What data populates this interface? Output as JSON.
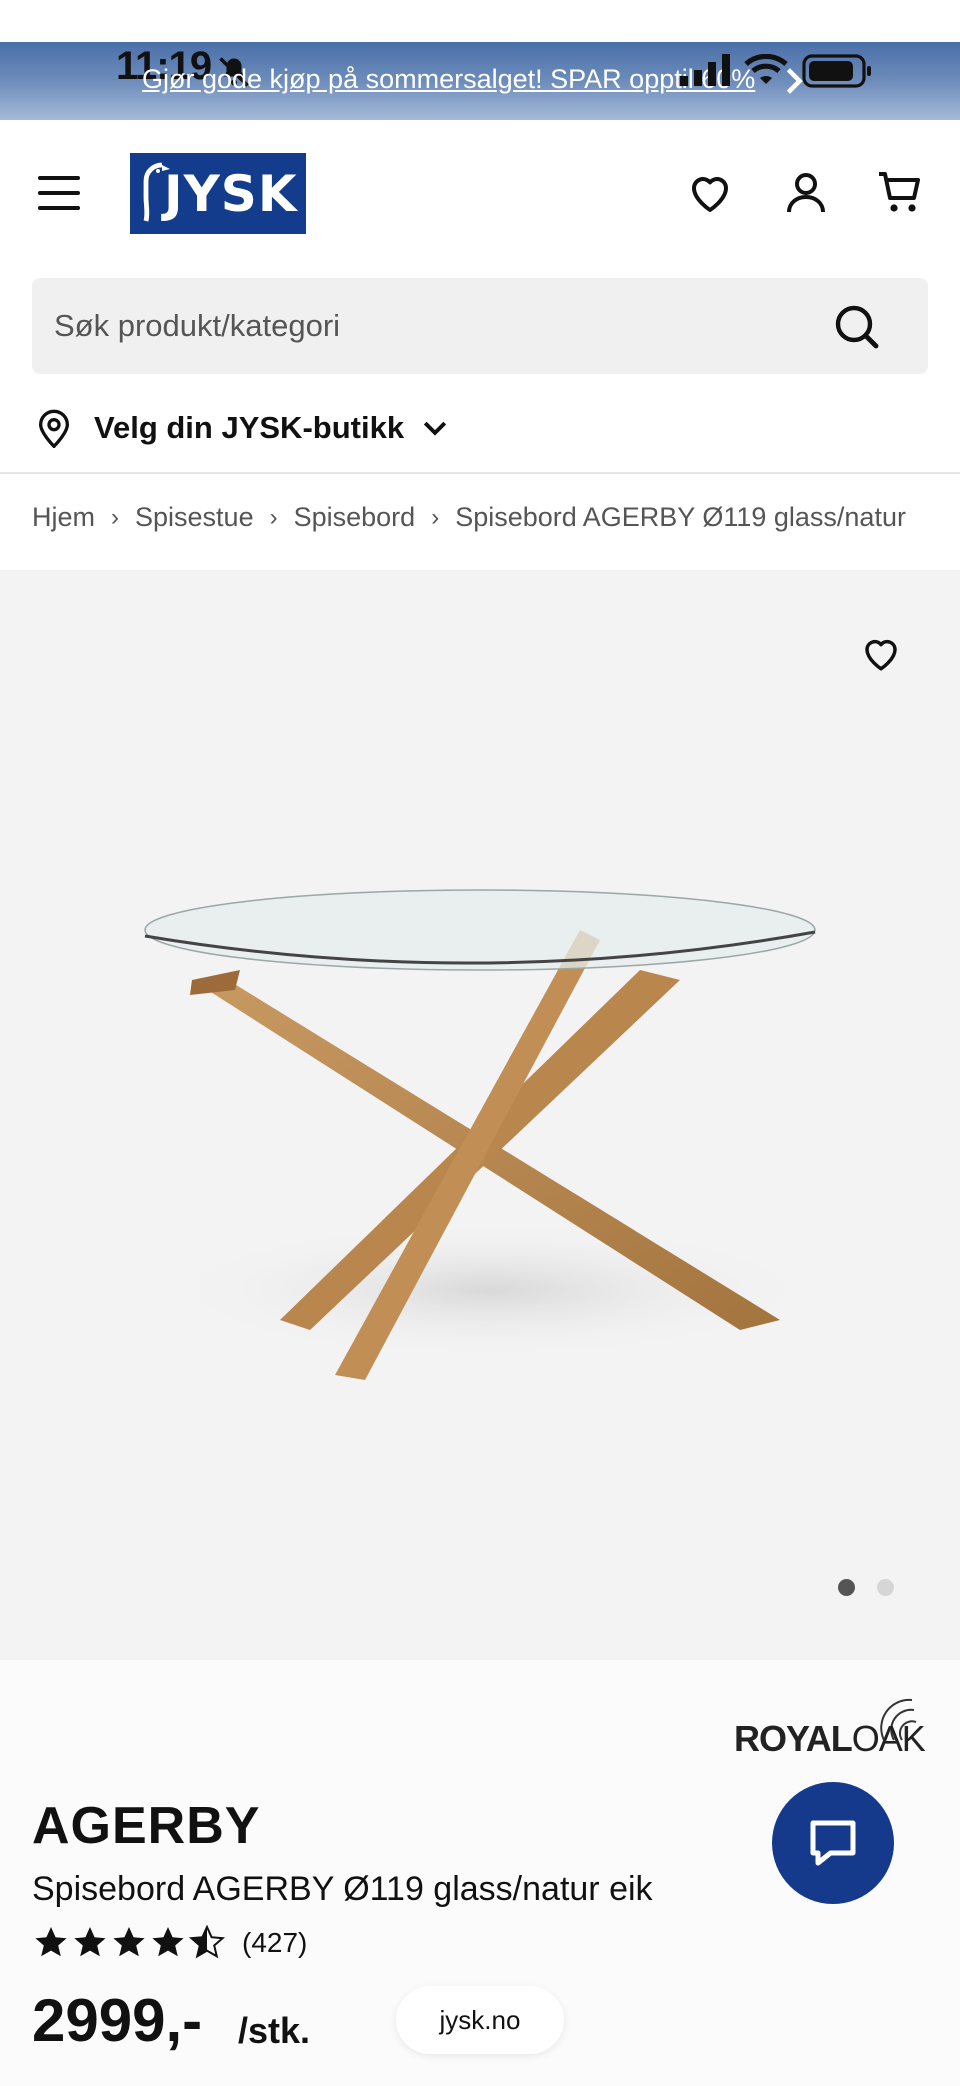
{
  "status_bar": {
    "time": "11:19"
  },
  "promo": {
    "text": "Gjør gode kjøp på sommersalget! SPAR opptil 60%"
  },
  "header": {
    "logo_text": "JYSK"
  },
  "search": {
    "placeholder": "Søk produkt/kategori"
  },
  "store": {
    "label": "Velg din JYSK-butikk"
  },
  "breadcrumb": [
    "Hjem",
    "Spisestue",
    "Spisebord",
    "Spisebord AGERBY Ø119 glass/natur"
  ],
  "gallery": {
    "active_slide": 1,
    "slide_count": 2
  },
  "product": {
    "brand_main": "ROYAL",
    "brand_sub": "OAK",
    "name": "AGERBY",
    "description": "Spisebord AGERBY Ø119 glass/natur eik",
    "rating": 4.5,
    "rating_count": "(427)",
    "price": "2999,-",
    "unit": "/stk."
  },
  "browser": {
    "url": "jysk.no"
  },
  "colors": {
    "brand_blue": "#143c8c",
    "gallery_bg": "#f3f3f3"
  }
}
